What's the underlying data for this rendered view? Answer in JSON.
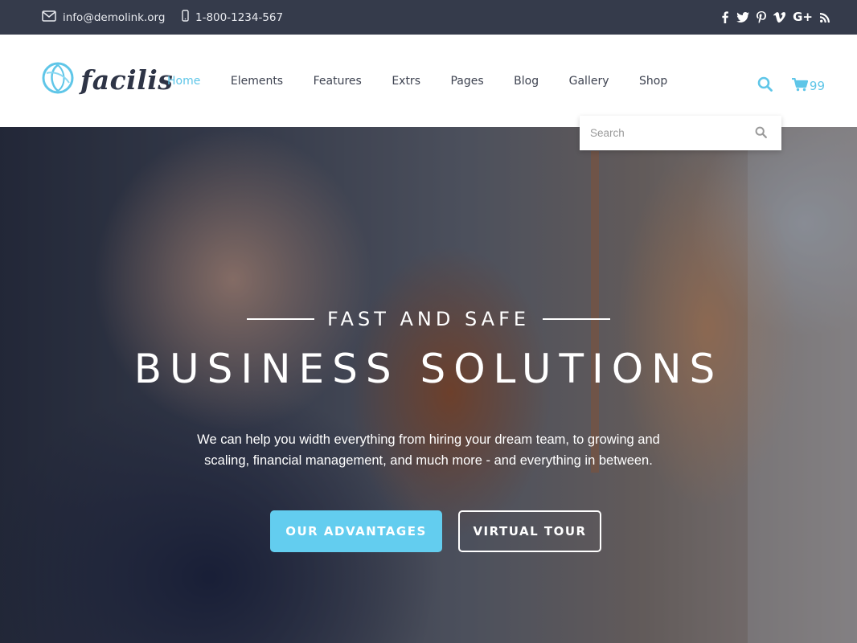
{
  "topbar": {
    "email": "info@demolink.org",
    "phone": "1-800-1234-567",
    "social": [
      {
        "name": "facebook-icon",
        "glyph": "f"
      },
      {
        "name": "twitter-icon",
        "glyph": "t"
      },
      {
        "name": "pinterest-icon",
        "glyph": "p"
      },
      {
        "name": "vimeo-icon",
        "glyph": "v"
      },
      {
        "name": "google-plus-icon",
        "glyph": "G+"
      },
      {
        "name": "rss-icon",
        "glyph": "rss"
      }
    ]
  },
  "brand": {
    "logo_text": "facilis"
  },
  "nav": {
    "items": [
      {
        "label": "Home",
        "active": true
      },
      {
        "label": "Elements"
      },
      {
        "label": "Features"
      },
      {
        "label": "Extrs"
      },
      {
        "label": "Pages"
      },
      {
        "label": "Blog"
      },
      {
        "label": "Gallery"
      },
      {
        "label": "Shop"
      }
    ]
  },
  "cart": {
    "count": "99"
  },
  "search": {
    "placeholder": "Search"
  },
  "hero": {
    "eyebrow": "FAST AND SAFE",
    "title": "BUSINESS SOLUTIONS",
    "description": "We can help you width everything from hiring your dream team, to growing and scaling, financial management, and much more - and everything in between.",
    "primary_button": "OUR ADVANTAGES",
    "secondary_button": "VIRTUAL TOUR"
  },
  "colors": {
    "accent": "#5fc6e8",
    "topbar_bg": "#353b4b",
    "text_dark": "#3d4250"
  }
}
